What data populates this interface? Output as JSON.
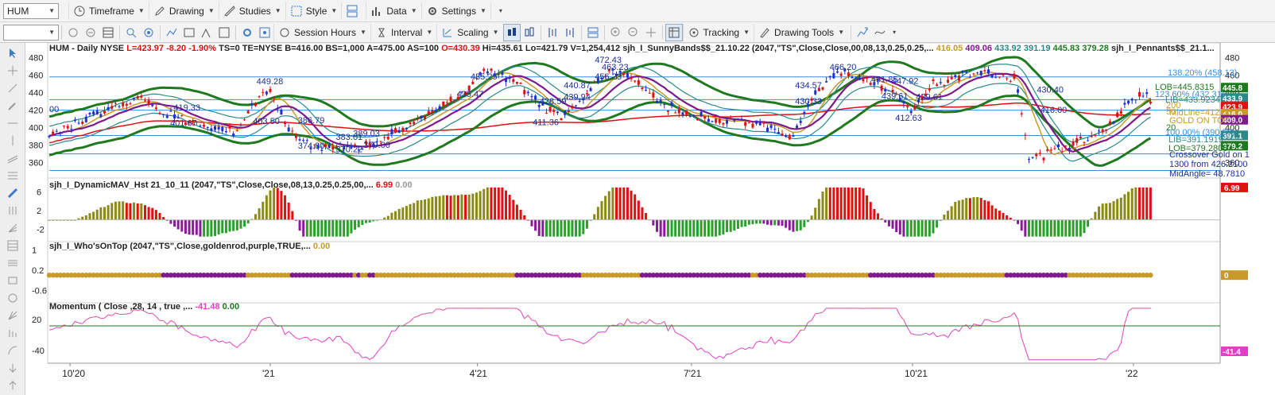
{
  "toolbar": {
    "symbol": "HUM",
    "timeframe": "Timeframe",
    "drawing": "Drawing",
    "studies": "Studies",
    "style": "Style",
    "data": "Data",
    "settings": "Settings",
    "session_hours": "Session Hours",
    "interval": "Interval",
    "scaling": "Scaling",
    "tracking": "Tracking",
    "drawing_tools": "Drawing Tools"
  },
  "header": {
    "symbol_line": "HUM - Daily  NYSE",
    "L": "L=423.97",
    "chg": "-8.20",
    "pct": "-1.90%",
    "ts": "TS=0",
    "te": "TE=NYSE",
    "b": "B=416.00",
    "bs": "BS=1,000",
    "a": "A=475.00",
    "as": "AS=100",
    "o": "O=430.39",
    "hi": "Hi=435.61",
    "lo": "Lo=421.79",
    "v": "V=1,254,412",
    "sunny": "sjh_I_SunnyBands$$_21.10.22 (2047,\"TS\",Close,Close,00,08,13,0.25,0.25,...",
    "sunny_vals": [
      "416.05",
      "409.06",
      "433.92",
      "391.19",
      "445.83",
      "379.28"
    ],
    "pennants": "sjh_I_Pennants$$_21.1..."
  },
  "colors": {
    "up_bar": "#1f2fd0",
    "down_bar": "#e01010",
    "green_band": "#1f7a1f",
    "teal_band": "#2a8a8a",
    "purple": "#7d1a8c",
    "goldenrod": "#c89a2a",
    "sma_red": "#e01010",
    "hline": "#3a8de0",
    "mom": "#e040c8",
    "osc_up": "#8b8b14",
    "osc_red": "#e01010",
    "osc_purple": "#8a1a9a",
    "osc_green": "#2aa02a"
  },
  "price_panel": {
    "ticks": [
      "480",
      "460",
      "440",
      "420",
      "400",
      "380",
      "360"
    ],
    "hlines": [
      458,
      432,
      420,
      391,
      370,
      351
    ],
    "annotations": [
      {
        "text": "449.28",
        "p": 449.5,
        "d": 60
      },
      {
        "text": "419.33",
        "p": 419.5,
        "d": 36
      },
      {
        "text": "401.67",
        "p": 402,
        "d": 35
      },
      {
        "text": "403.50",
        "p": 404,
        "d": 59
      },
      {
        "text": "386.79",
        "p": 405,
        "d": 72
      },
      {
        "text": "374.80",
        "p": 376,
        "d": 72
      },
      {
        "text": "389.03",
        "p": 390,
        "d": 88
      },
      {
        "text": "383.01",
        "p": 386,
        "d": 83
      },
      {
        "text": "379.00",
        "p": 377,
        "d": 91
      },
      {
        "text": "370.22",
        "p": 372,
        "d": 83
      },
      {
        "text": "435.25",
        "p": 455,
        "d": 122
      },
      {
        "text": "435.47",
        "p": 435,
        "d": 118
      },
      {
        "text": "428.59",
        "p": 427,
        "d": 142
      },
      {
        "text": "411.36",
        "p": 403,
        "d": 140
      },
      {
        "text": "440.87",
        "p": 445,
        "d": 149
      },
      {
        "text": "439.94",
        "p": 432,
        "d": 149
      },
      {
        "text": "472.43",
        "p": 474,
        "d": 158
      },
      {
        "text": "463.23",
        "p": 466,
        "d": 160
      },
      {
        "text": "456.23",
        "p": 455,
        "d": 158
      },
      {
        "text": "434.57",
        "p": 445,
        "d": 216
      },
      {
        "text": "430.33",
        "p": 427,
        "d": 216
      },
      {
        "text": "466.20",
        "p": 466,
        "d": 226
      },
      {
        "text": "451.85",
        "p": 452,
        "d": 238
      },
      {
        "text": "447.92",
        "p": 450,
        "d": 244
      },
      {
        "text": "439.61",
        "p": 433,
        "d": 241
      },
      {
        "text": "429.61",
        "p": 432,
        "d": 251
      },
      {
        "text": "412.63",
        "p": 408,
        "d": 245
      },
      {
        "text": "430.40",
        "p": 440,
        "d": 286
      },
      {
        "text": "416.00",
        "p": 417,
        "d": 287
      },
      {
        "text": "00",
        "p": 418,
        "d": 0
      }
    ],
    "right_notes": {
      "r138": "138.20% (458.13)",
      "r123": "123.60% (432.31)",
      "r100": "100.00% (390.57)",
      "r76": "76.40% (348.83)",
      "lob": "LOB=445.8315",
      "lib": "LIB=433.9234",
      "midline": "MidLine=412.56",
      "gold_on_top": "GOLD ON TOP",
      "lib2": "LIB=391.1919",
      "lob2": "LOB=379.2806",
      "cross1": "Crossover Gold on 1",
      "cross2": "1300 from 426.2100",
      "midangle": "MidAngle= 48.7810",
      "n200": "200",
      "n50": "50",
      "n20": "20"
    },
    "right_tags": [
      {
        "text": "445.8",
        "p": 445.8,
        "bg": "#1f7a1f",
        "fg": "#fff"
      },
      {
        "text": "433.9",
        "p": 433.9,
        "bg": "#2a8a8a",
        "fg": "#fff"
      },
      {
        "text": "423.9",
        "p": 424.0,
        "bg": "#e01010",
        "fg": "#fff"
      },
      {
        "text": "416.0",
        "p": 416.0,
        "bg": "#c89a2a",
        "fg": "#fff"
      },
      {
        "text": "409.0",
        "p": 409.0,
        "bg": "#7d1a8c",
        "fg": "#fff"
      },
      {
        "text": "391.1",
        "p": 391.2,
        "bg": "#2a8a8a",
        "fg": "#fff"
      },
      {
        "text": "379.2",
        "p": 379.3,
        "bg": "#1f7a1f",
        "fg": "#fff"
      }
    ]
  },
  "osc_panel": {
    "label": "sjh_I_DynamicMAV_Hst 21_10_11 (2047,\"TS\",Close,Close,08,13,0.25,0.25,00,...",
    "v1": "6.99",
    "v2": "0.00",
    "ticks": [
      "6",
      "2",
      "-2"
    ],
    "tag": "6.99"
  },
  "who_panel": {
    "label": "sjh_I_Who'sOnTop (2047,\"TS\",Close,goldenrod,purple,TRUE,...",
    "v1": "0.00",
    "ticks": [
      "1",
      "0.2",
      "-0.6"
    ],
    "tag": "0"
  },
  "mom_panel": {
    "label": "Momentum ( Close ,28, 14 , true ,...",
    "v1": "-41.48",
    "v2": "0.00",
    "ticks": [
      "20",
      "-40"
    ],
    "tag": "-41.4"
  },
  "x_axis": {
    "labels": [
      {
        "text": "10'20",
        "d": 6
      },
      {
        "text": "'21",
        "d": 64
      },
      {
        "text": "4'21",
        "d": 124
      },
      {
        "text": "7'21",
        "d": 186
      },
      {
        "text": "10'21",
        "d": 250
      },
      {
        "text": "'22",
        "d": 314
      }
    ]
  }
}
